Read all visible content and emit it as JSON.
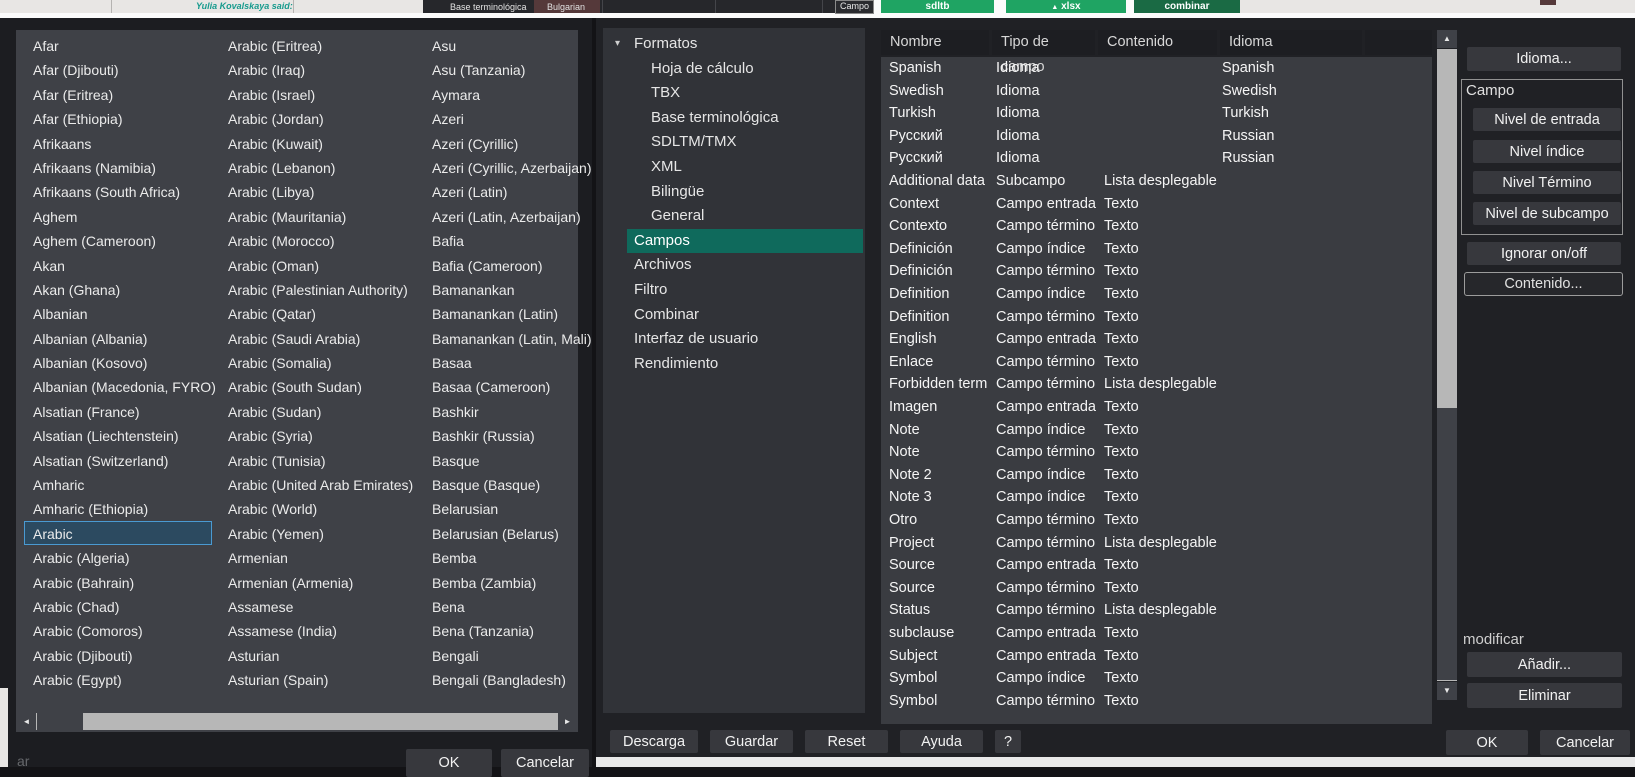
{
  "background_strip": {
    "quote_text": "Yulia Kovalskaya said:",
    "window_label_1": "Base terminológica",
    "window_label_2": "Bulgarian",
    "campo_label": "Campo",
    "green_buttons": [
      "sdltb",
      "xlsx",
      "combinar"
    ],
    "icons": {
      "xlsx_arrow": "▲"
    }
  },
  "language_dialog": {
    "selected": "Arabic",
    "filter_text": "ar",
    "ok_label": "OK",
    "cancel_label": "Cancelar",
    "columns": [
      [
        "Afar",
        "Afar (Djibouti)",
        "Afar (Eritrea)",
        "Afar (Ethiopia)",
        "Afrikaans",
        "Afrikaans (Namibia)",
        "Afrikaans (South Africa)",
        "Aghem",
        "Aghem (Cameroon)",
        "Akan",
        "Akan (Ghana)",
        "Albanian",
        "Albanian (Albania)",
        "Albanian (Kosovo)",
        "Albanian (Macedonia, FYRO)",
        "Alsatian (France)",
        "Alsatian (Liechtenstein)",
        "Alsatian (Switzerland)",
        "Amharic",
        "Amharic (Ethiopia)",
        "Arabic",
        "Arabic (Algeria)",
        "Arabic (Bahrain)",
        "Arabic (Chad)",
        "Arabic (Comoros)",
        "Arabic (Djibouti)",
        "Arabic (Egypt)"
      ],
      [
        "Arabic (Eritrea)",
        "Arabic (Iraq)",
        "Arabic (Israel)",
        "Arabic (Jordan)",
        "Arabic (Kuwait)",
        "Arabic (Lebanon)",
        "Arabic (Libya)",
        "Arabic (Mauritania)",
        "Arabic (Morocco)",
        "Arabic (Oman)",
        "Arabic (Palestinian Authority)",
        "Arabic (Qatar)",
        "Arabic (Saudi Arabia)",
        "Arabic (Somalia)",
        "Arabic (South Sudan)",
        "Arabic (Sudan)",
        "Arabic (Syria)",
        "Arabic (Tunisia)",
        "Arabic (United Arab Emirates)",
        "Arabic (World)",
        "Arabic (Yemen)",
        "Armenian",
        "Armenian (Armenia)",
        "Assamese",
        "Assamese (India)",
        "Asturian",
        "Asturian (Spain)"
      ],
      [
        "Asu",
        "Asu (Tanzania)",
        "Aymara",
        "Azeri",
        "Azeri (Cyrillic)",
        "Azeri (Cyrillic, Azerbaijan)",
        "Azeri (Latin)",
        "Azeri (Latin, Azerbaijan)",
        "Bafia",
        "Bafia (Cameroon)",
        "Bamanankan",
        "Bamanankan (Latin)",
        "Bamanankan (Latin, Mali)",
        "Basaa",
        "Basaa (Cameroon)",
        "Bashkir",
        "Bashkir (Russia)",
        "Basque",
        "Basque (Basque)",
        "Belarusian",
        "Belarusian (Belarus)",
        "Bemba",
        "Bemba (Zambia)",
        "Bena",
        "Bena (Tanzania)",
        "Bengali",
        "Bengali (Bangladesh)"
      ]
    ],
    "scrollbar_icons": {
      "left": "◄",
      "right": "►"
    }
  },
  "settings_dialog": {
    "tree": [
      {
        "label": "Formatos",
        "level": 0,
        "expanded": true
      },
      {
        "label": "Hoja de cálculo",
        "level": 1
      },
      {
        "label": "TBX",
        "level": 1
      },
      {
        "label": "Base terminológica",
        "level": 1
      },
      {
        "label": "SDLTM/TMX",
        "level": 1
      },
      {
        "label": "XML",
        "level": 1
      },
      {
        "label": "Bilingüe",
        "level": 1
      },
      {
        "label": "General",
        "level": 1
      },
      {
        "label": "Campos",
        "level": 0,
        "selected": true
      },
      {
        "label": "Archivos",
        "level": 0
      },
      {
        "label": "Filtro",
        "level": 0
      },
      {
        "label": "Combinar",
        "level": 0
      },
      {
        "label": "Interfaz de usuario",
        "level": 0
      },
      {
        "label": "Rendimiento",
        "level": 0
      }
    ],
    "tree_expand_icon": "▾",
    "bottom_buttons": [
      "Descarga",
      "Guardar",
      "Reset",
      "Ayuda",
      "?"
    ],
    "table": {
      "headers": [
        "Nombre",
        "Tipo de campo",
        "Contenido",
        "Idioma",
        ""
      ],
      "rows": [
        [
          "Spanish",
          "Idioma",
          "",
          "Spanish"
        ],
        [
          "Swedish",
          "Idioma",
          "",
          "Swedish"
        ],
        [
          "Turkish",
          "Idioma",
          "",
          "Turkish"
        ],
        [
          "Русский",
          "Idioma",
          "",
          "Russian"
        ],
        [
          "Русский",
          "Idioma",
          "",
          "Russian"
        ],
        [
          "Additional data",
          "Subcampo",
          "Lista desplegable",
          ""
        ],
        [
          "Context",
          "Campo entrada",
          "Texto",
          ""
        ],
        [
          "Contexto",
          "Campo término",
          "Texto",
          ""
        ],
        [
          "Definición",
          "Campo índice",
          "Texto",
          ""
        ],
        [
          "Definición",
          "Campo término",
          "Texto",
          ""
        ],
        [
          "Definition",
          "Campo índice",
          "Texto",
          ""
        ],
        [
          "Definition",
          "Campo término",
          "Texto",
          ""
        ],
        [
          "English",
          "Campo entrada",
          "Texto",
          ""
        ],
        [
          "Enlace",
          "Campo término",
          "Texto",
          ""
        ],
        [
          "Forbidden term",
          "Campo término",
          "Lista desplegable",
          ""
        ],
        [
          "Imagen",
          "Campo entrada",
          "Texto",
          ""
        ],
        [
          "Note",
          "Campo índice",
          "Texto",
          ""
        ],
        [
          "Note",
          "Campo término",
          "Texto",
          ""
        ],
        [
          "Note 2",
          "Campo índice",
          "Texto",
          ""
        ],
        [
          "Note 3",
          "Campo índice",
          "Texto",
          ""
        ],
        [
          "Otro",
          "Campo término",
          "Texto",
          ""
        ],
        [
          "Project",
          "Campo término",
          "Lista desplegable",
          ""
        ],
        [
          "Source",
          "Campo entrada",
          "Texto",
          ""
        ],
        [
          "Source",
          "Campo término",
          "Texto",
          ""
        ],
        [
          "Status",
          "Campo término",
          "Lista desplegable",
          ""
        ],
        [
          "subclause",
          "Campo entrada",
          "Texto",
          ""
        ],
        [
          "Subject",
          "Campo entrada",
          "Texto",
          ""
        ],
        [
          "Symbol",
          "Campo índice",
          "Texto",
          ""
        ],
        [
          "Symbol",
          "Campo término",
          "Texto",
          ""
        ]
      ]
    },
    "scrollbar_icons": {
      "up": "▲",
      "down": "▼"
    },
    "right_panel": {
      "idioma_button": "Idioma...",
      "campo_group_label": "Campo",
      "campo_buttons": [
        "Nivel de entrada",
        "Nivel índice",
        "Nivel Término",
        "Nivel de subcampo"
      ],
      "ignorar_button": "Ignorar on/off",
      "contenido_button": "Contenido...",
      "modificar_label": "modificar",
      "anadir_button": "Añadir...",
      "eliminar_button": "Eliminar",
      "ok_label": "OK",
      "cancel_label": "Cancelar"
    },
    "colors": {
      "tree_selected_bg": "#0f6a5c",
      "list_selected_border": "#4a9ad2",
      "green_accent": "#1fa463"
    }
  }
}
